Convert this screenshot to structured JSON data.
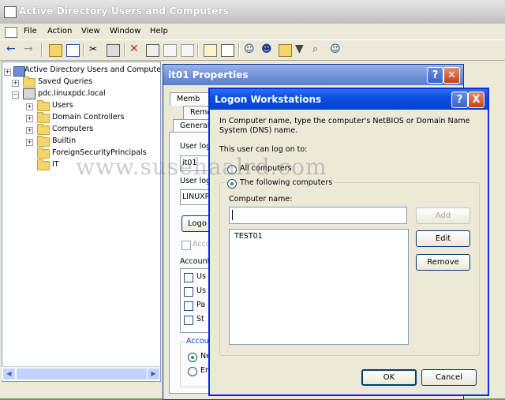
{
  "window": {
    "title": "Active Directory Users and Computers"
  },
  "menu": [
    "File",
    "Action",
    "View",
    "Window",
    "Help"
  ],
  "tree": {
    "root": "Active Directory Users and Computer",
    "saved_queries": "Saved Queries",
    "domain": "pdc.linuxpdc.local",
    "children": [
      "Users",
      "Domain Controllers",
      "Computers",
      "Builtin",
      "ForeignSecurityPrincipals",
      "IT"
    ]
  },
  "props": {
    "title": "it01 Properties",
    "tabs": [
      "Memb",
      "Remo",
      "General"
    ],
    "user_logon_label_1": "User log",
    "user_logon_value_1": "it01",
    "user_logon_label_2": "User log",
    "user_logon_value_2": "LINUXP",
    "logon_button": "Logo",
    "account_check": "Acco",
    "account_options_label": "Account",
    "option_rows": [
      "Us",
      "Us",
      "Pa",
      "St"
    ],
    "expires_label": "Accou",
    "expires_options": [
      "Ne",
      "En"
    ]
  },
  "dialog": {
    "title": "Logon Workstations",
    "help_button": "?",
    "close_button": "X",
    "description": "In Computer name, type the computer's NetBIOS or Domain Name System (DNS) name.",
    "can_logon_label": "This user can log on to:",
    "radio_all": "All computers",
    "radio_following": "The following computers",
    "computer_name_label": "Computer name:",
    "computer_name_value": "",
    "add_button": "Add",
    "edit_button": "Edit",
    "remove_button": "Remove",
    "list_items": [
      "TEST01"
    ],
    "ok_button": "OK",
    "cancel_button": "Cancel"
  },
  "watermark": "www.susehaalrd.com"
}
